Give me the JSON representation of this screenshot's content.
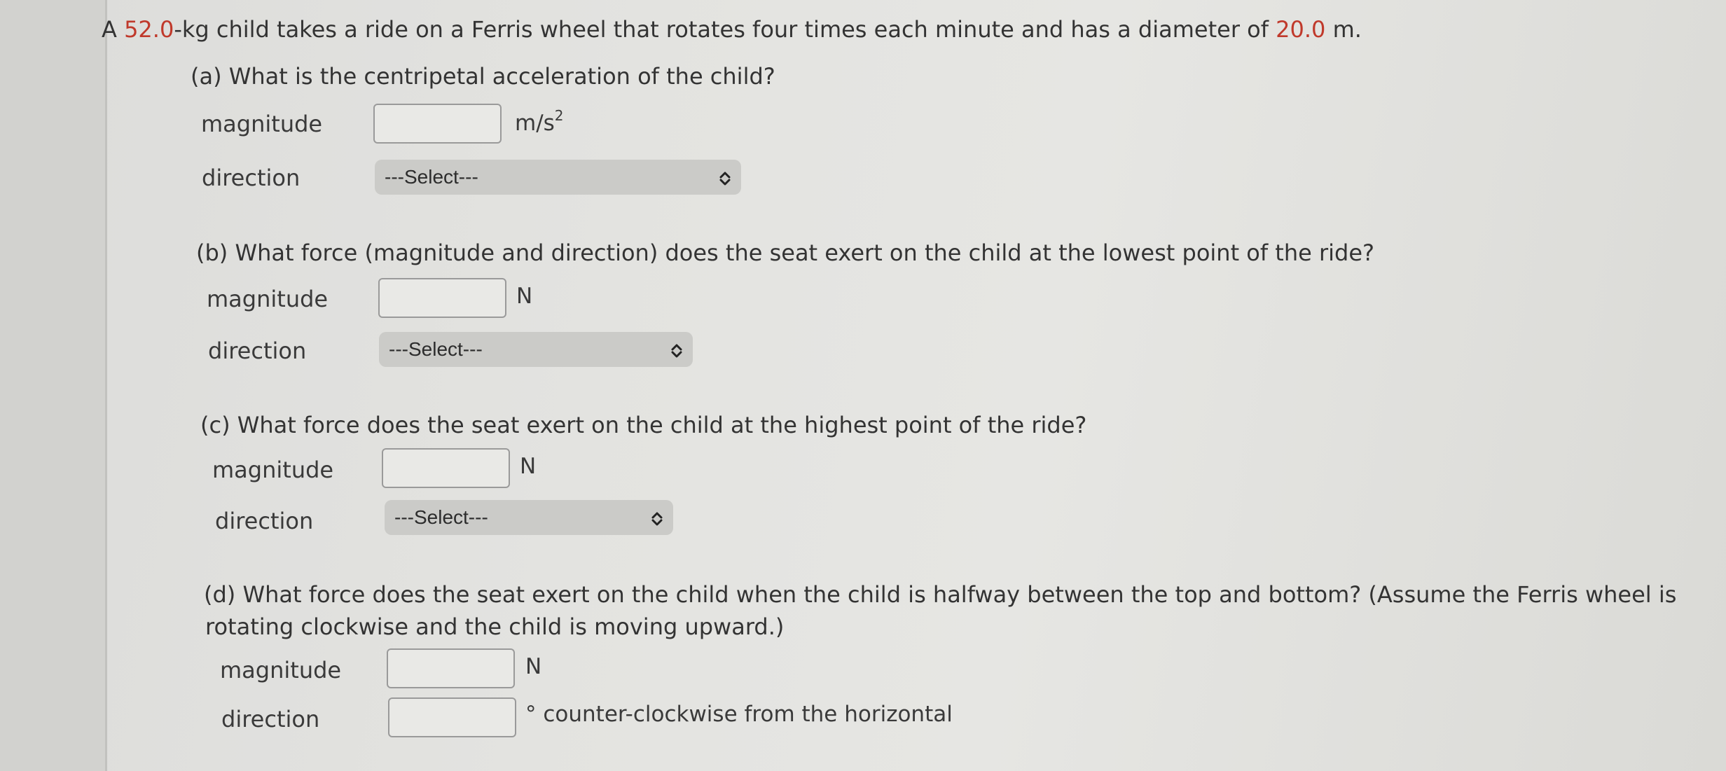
{
  "problem": {
    "prefix": "A ",
    "mass": "52.0",
    "middle": "-kg child takes a ride on a Ferris wheel that rotates four times each minute and has a diameter of ",
    "diameter": "20.0",
    "suffix": " m."
  },
  "parts": {
    "a": {
      "question": "(a) What is the centripetal acceleration of the child?",
      "magnitude_label": "magnitude",
      "magnitude_value": "",
      "unit_base": "m/s",
      "unit_exp": "2",
      "direction_label": "direction",
      "direction_selected": "---Select---"
    },
    "b": {
      "question": "(b) What force (magnitude and direction) does the seat exert on the child at the lowest point of the ride?",
      "magnitude_label": "magnitude",
      "magnitude_value": "",
      "unit": "N",
      "direction_label": "direction",
      "direction_selected": "---Select---"
    },
    "c": {
      "question": "(c) What force does the seat exert on the child at the highest point of the ride?",
      "magnitude_label": "magnitude",
      "magnitude_value": "",
      "unit": "N",
      "direction_label": "direction",
      "direction_selected": "---Select---"
    },
    "d": {
      "question_line1": "(d) What force does the seat exert on the child when the child is halfway between the top and bottom? (Assume the Ferris wheel is",
      "question_line2": "rotating clockwise and the child is moving upward.)",
      "magnitude_label": "magnitude",
      "magnitude_value": "",
      "unit": "N",
      "direction_label": "direction",
      "direction_value": "",
      "direction_unit": "° counter-clockwise from the horizontal"
    }
  },
  "icons": {
    "select_arrows": "⌃⌄"
  }
}
